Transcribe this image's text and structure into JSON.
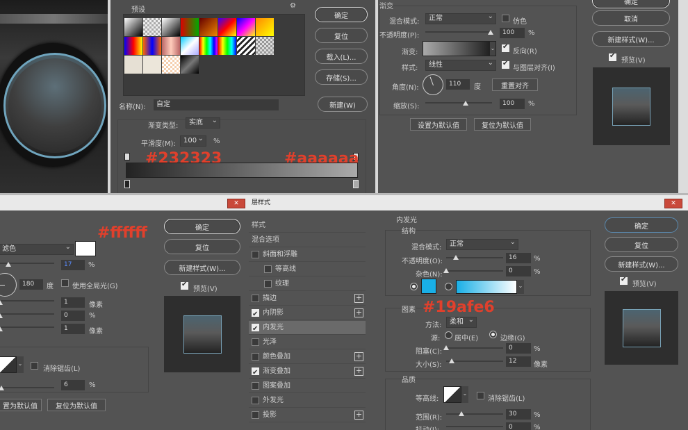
{
  "colors": {
    "c1": "#232323",
    "c2": "#aaaaaa",
    "c3": "#ffffff",
    "c4": "#19afe6"
  },
  "grad_editor": {
    "presets_label": "预设",
    "gear": "⚙",
    "ok": "确定",
    "reset": "复位",
    "load": "载入(L)...",
    "save": "存储(S)...",
    "name_label": "名称(N):",
    "name_value": "自定",
    "new": "新建(W)",
    "type_label": "渐变类型:",
    "type_value": "实底",
    "smooth_label": "平滑度(M):",
    "smooth_value": "100",
    "smooth_unit": "%",
    "annot_left": "#232323",
    "annot_right": "#aaaaaa"
  },
  "gradient_overlay": {
    "title": "渐变",
    "blend_label": "混合模式:",
    "blend_value": "正常",
    "dither": "仿色",
    "opacity_label": "不透明度(P):",
    "opacity_value": "100",
    "opacity_unit": "%",
    "gradient_label": "渐变:",
    "reverse": "反向(R)",
    "style_label": "样式:",
    "style_value": "线性",
    "align": "与图层对齐(I)",
    "angle_label": "角度(N):",
    "angle_value": "110",
    "angle_unit": "度",
    "reset_align": "重置对齐",
    "scale_label": "缩放(S):",
    "scale_value": "100",
    "scale_unit": "%",
    "make_default": "设置为默认值",
    "reset_default": "复位为默认值"
  },
  "right_top": {
    "ok": "确定",
    "cancel": "取消",
    "new_style": "新建样式(W)...",
    "preview": "预览(V)"
  },
  "stroke_dialog": {
    "annot": "#ffffff",
    "blend_value": "滤色",
    "opacity_value": "17",
    "opacity_unit": "%",
    "angle_value": "180",
    "angle_unit": "度",
    "global_light": "使用全局光(G)",
    "distance_value": "1",
    "distance_unit": "像素",
    "choke_value": "0",
    "choke_unit": "%",
    "size_value": "1",
    "size_unit": "像素",
    "antialias": "消除锯齿(L)",
    "noise_value": "6",
    "noise_unit": "%",
    "make_default": "置为默认值",
    "reset_default": "复位为默认值",
    "ok": "确定",
    "reset": "复位",
    "new_style": "新建样式(W)...",
    "preview": "预览(V)"
  },
  "layer_style": {
    "title": "层样式",
    "list_header": "样式",
    "items": [
      {
        "label": "混合选项",
        "checked": null,
        "plus": false,
        "indent": false
      },
      {
        "label": "斜面和浮雕",
        "checked": false,
        "plus": false,
        "indent": false
      },
      {
        "label": "等高线",
        "checked": false,
        "plus": false,
        "indent": true
      },
      {
        "label": "纹理",
        "checked": false,
        "plus": false,
        "indent": true
      },
      {
        "label": "描边",
        "checked": false,
        "plus": true,
        "indent": false
      },
      {
        "label": "内阴影",
        "checked": true,
        "plus": true,
        "indent": false
      },
      {
        "label": "内发光",
        "checked": true,
        "plus": false,
        "indent": false
      },
      {
        "label": "光泽",
        "checked": false,
        "plus": false,
        "indent": false
      },
      {
        "label": "颜色叠加",
        "checked": false,
        "plus": true,
        "indent": false
      },
      {
        "label": "渐变叠加",
        "checked": true,
        "plus": true,
        "indent": false
      },
      {
        "label": "图案叠加",
        "checked": false,
        "plus": false,
        "indent": false
      },
      {
        "label": "外发光",
        "checked": false,
        "plus": false,
        "indent": false
      },
      {
        "label": "投影",
        "checked": false,
        "plus": true,
        "indent": false
      }
    ],
    "section": "内发光",
    "structure": "结构",
    "blend_label": "混合模式:",
    "blend_value": "正常",
    "opacity_label": "不透明度(O):",
    "opacity_value": "16",
    "opacity_unit": "%",
    "noise_label": "杂色(N):",
    "noise_value": "0",
    "noise_unit": "%",
    "elements": "图素",
    "annot": "#19afe6",
    "method_label": "方法:",
    "method_value": "柔和",
    "source_label": "源:",
    "center": "居中(E)",
    "edge": "边缘(G)",
    "choke_label": "阻塞(C):",
    "choke_value": "0",
    "choke_unit": "%",
    "size_label": "大小(S):",
    "size_value": "12",
    "size_unit": "像素",
    "quality": "品质",
    "contour_label": "等高线:",
    "antialias": "消除锯齿(L)",
    "range_label": "范围(R):",
    "range_value": "30",
    "range_unit": "%",
    "jitter_label": "抖动(J):",
    "jitter_value": "0",
    "jitter_unit": "%",
    "ok": "确定",
    "reset": "复位",
    "new_style": "新建样式(W)...",
    "preview": "预览(V)"
  }
}
